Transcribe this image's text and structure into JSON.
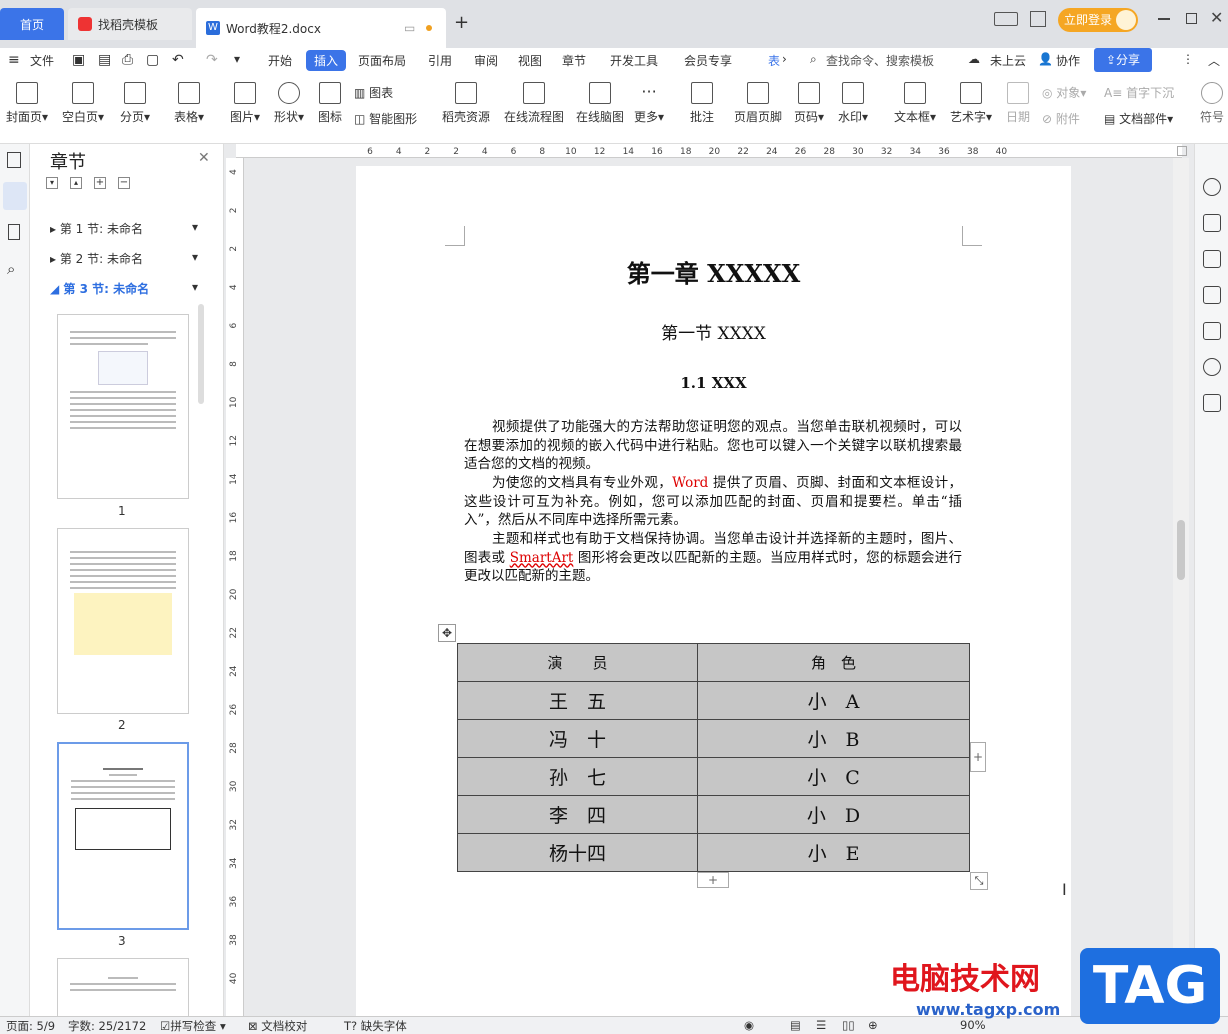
{
  "tabs": {
    "home": "首页",
    "store": "找稻壳模板",
    "doc": "Word教程2.docx",
    "new": "+"
  },
  "window": {
    "login": "立即登录",
    "icons": [
      "layout-icon",
      "grid-icon",
      "minimize-icon",
      "maximize-icon",
      "close-icon"
    ]
  },
  "menu": {
    "file": "文件",
    "items": [
      "开始",
      "插入",
      "页面布局",
      "引用",
      "审阅",
      "视图",
      "章节",
      "开发工具",
      "会员专享",
      "表"
    ],
    "active": "插入",
    "search": "查找命令、搜索模板",
    "cloud": "未上云",
    "collab": "协作",
    "share": "分享"
  },
  "ribbon": {
    "big": [
      "封面页",
      "空白页",
      "分页",
      "表格",
      "图片",
      "形状",
      "图标",
      "稻壳资源",
      "在线流程图",
      "在线脑图",
      "更多",
      "批注",
      "页眉页脚",
      "页码",
      "水印",
      "文本框",
      "艺术字",
      "日期",
      "文档部件",
      "符号"
    ],
    "small": {
      "chart": "图表",
      "smart": "智能图形",
      "object": "对象",
      "dropcap": "首字下沉",
      "attach": "附件"
    }
  },
  "nav": {
    "title": "章节",
    "sections": [
      "第 1 节: 未命名",
      "第 2 节: 未命名",
      "第 3 节: 未命名"
    ],
    "pages": [
      "1",
      "2",
      "3"
    ]
  },
  "ruler": {
    "h": [
      "6",
      "4",
      "2",
      "2",
      "4",
      "6",
      "8",
      "10",
      "12",
      "14",
      "16",
      "18",
      "20",
      "22",
      "24",
      "26",
      "28",
      "30",
      "32",
      "34",
      "36",
      "38",
      "40"
    ],
    "v": [
      "4",
      "2",
      "2",
      "4",
      "6",
      "8",
      "10",
      "12",
      "14",
      "16",
      "18",
      "20",
      "22",
      "24",
      "26",
      "28",
      "30",
      "32",
      "34",
      "36",
      "38",
      "40"
    ]
  },
  "doc": {
    "chapter": "第一章  XXXXX",
    "section": "第一节  XXXX",
    "sub": "1.1 XXX",
    "p1": "视频提供了功能强大的方法帮助您证明您的观点。当您单击联机视频时，可以在想要添加的视频的嵌入代码中进行粘贴。您也可以键入一个关键字以联机搜索最适合您的文档的视频。",
    "p2a": "为使您的文档具有专业外观，",
    "p2word": "Word",
    "p2b": " 提供了页眉、页脚、封面和文本框设计，这些设计可互为补充。例如，您可以添加匹配的封面、页眉和提要栏。单击“插入”，然后从不同库中选择所需元素。",
    "p3a": "主题和样式也有助于文档保持协调。当您单击设计并选择新的主题时，图片、图表或 ",
    "p3sa": "SmartArt",
    "p3b": " 图形将会更改以匹配新的主题。当应用样式时，您的标题会进行更改以匹配新的主题。",
    "table": {
      "headers": [
        "演　　员",
        "角　色"
      ],
      "rows": [
        [
          "王　五",
          "小　A"
        ],
        [
          "冯　十",
          "小　B"
        ],
        [
          "孙　七",
          "小　C"
        ],
        [
          "李　四",
          "小　D"
        ],
        [
          "杨十四",
          "小　E"
        ]
      ]
    }
  },
  "status": {
    "page": "页面: 5/9",
    "words": "字数: 25/2172",
    "spell": "拼写检查",
    "proof": "文档校对",
    "font": "缺失字体",
    "zoom": "90%"
  },
  "watermark": {
    "site": "电脑技术网",
    "url": "www.tagxp.com",
    "logo": "TAG"
  }
}
